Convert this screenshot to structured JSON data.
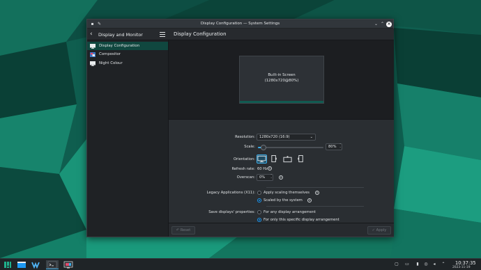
{
  "window": {
    "title": "Display Configuration — System Settings"
  },
  "sidebar": {
    "title": "Display and Monitor",
    "items": [
      {
        "label": "Display Configuration",
        "icon": "monitor-icon",
        "selected": true
      },
      {
        "label": "Compositor",
        "icon": "compositor-icon",
        "selected": false
      },
      {
        "label": "Night Colour",
        "icon": "monitor-icon",
        "selected": false
      }
    ]
  },
  "main": {
    "title": "Display Configuration",
    "screen": {
      "name": "Built-in Screen",
      "mode": "(1280x720@80%)"
    },
    "settings": {
      "resolution_label": "Resolution:",
      "resolution_value": "1280x720 (16:9)",
      "scale_label": "Scale:",
      "scale_value": "80%",
      "scale_fraction": 0.08,
      "orientation_label": "Orientation:",
      "refresh_label": "Refresh rate:",
      "refresh_value": "60 Hz",
      "overscan_label": "Overscan:",
      "overscan_value": "0%",
      "legacy_label": "Legacy Applications (X11):",
      "legacy_options": [
        {
          "label": "Apply scaling themselves",
          "checked": false
        },
        {
          "label": "Scaled by the system",
          "checked": true
        }
      ],
      "save_label": "Save displays' properties:",
      "save_options": [
        {
          "label": "For any display arrangement",
          "checked": false
        },
        {
          "label": "For only this specific display arrangement",
          "checked": true
        }
      ]
    },
    "footer": {
      "reset_label": "Reset",
      "apply_label": "Apply"
    }
  },
  "taskbar": {
    "time": "10:37:35",
    "date": "2023-11-19"
  },
  "colors": {
    "accent": "#3daee9",
    "selection": "#10473f",
    "wallpaper": "#0d5a4c"
  }
}
